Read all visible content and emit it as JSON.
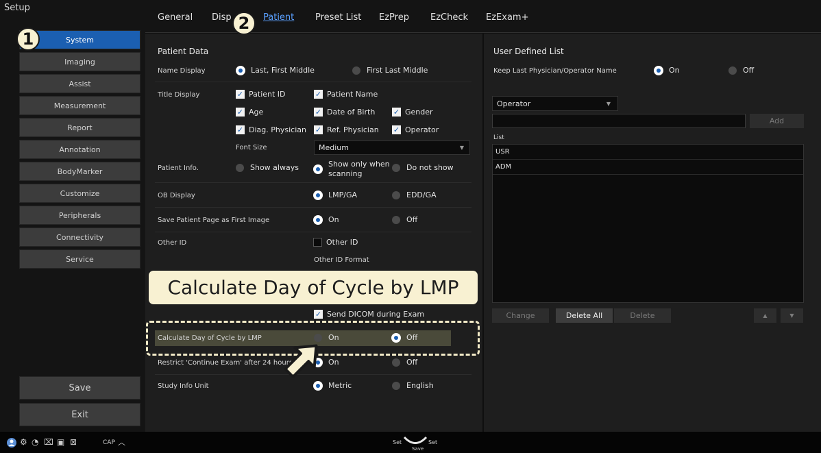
{
  "sidebar": {
    "title": "Setup",
    "items": [
      "System",
      "Imaging",
      "Assist",
      "Measurement",
      "Report",
      "Annotation",
      "BodyMarker",
      "Customize",
      "Peripherals",
      "Connectivity",
      "Service"
    ],
    "save": "Save",
    "exit": "Exit"
  },
  "tabs": [
    "General",
    "Disp",
    "Patient",
    "Preset List",
    "EzPrep",
    "EzCheck",
    "EzExam+"
  ],
  "badges": {
    "one": "1",
    "two": "2"
  },
  "patient": {
    "section": "Patient Data",
    "name_display": {
      "label": "Name Display",
      "opt1": "Last, First Middle",
      "opt2": "First Last Middle"
    },
    "title_display": {
      "label": "Title Display",
      "checks": [
        "Patient ID",
        "Patient Name",
        "Age",
        "Date of Birth",
        "Gender",
        "Diag. Physician",
        "Ref. Physician",
        "Operator"
      ],
      "font_size_label": "Font Size",
      "font_size_value": "Medium"
    },
    "patient_info": {
      "label": "Patient Info.",
      "opt1": "Show always",
      "opt2_line1": "Show only when",
      "opt2_line2": "scanning",
      "opt3": "Do not show"
    },
    "ob_display": {
      "label": "OB Display",
      "opt1": "LMP/GA",
      "opt2": "EDD/GA"
    },
    "save_first": {
      "label": "Save Patient Page as First Image",
      "opt1": "On",
      "opt2": "Off"
    },
    "other_id": {
      "label": "Other ID",
      "check": "Other ID",
      "format": "Other ID Format"
    },
    "send_dicom": "Send DICOM during Exam",
    "calc_cycle": {
      "label": "Calculate Day of Cycle by LMP",
      "opt1": "On",
      "opt2": "Off"
    },
    "restrict": {
      "label": "Restrict 'Continue Exam' after 24 hours",
      "opt1": "On",
      "opt2": "Off"
    },
    "study_unit": {
      "label": "Study Info Unit",
      "opt1": "Metric",
      "opt2": "English"
    }
  },
  "callout": "Calculate Day of Cycle by LMP",
  "user_list": {
    "section": "User Defined List",
    "keep_label": "Keep Last Physician/Operator Name",
    "opt1": "On",
    "opt2": "Off",
    "dropdown": "Operator",
    "add": "Add",
    "list_label": "List",
    "items": [
      "USR",
      "ADM"
    ],
    "change": "Change",
    "delete_all": "Delete All",
    "delete": "Delete"
  },
  "status": {
    "cap": "CAP",
    "set_left": "Set",
    "set_right": "Set",
    "save": "Save"
  }
}
